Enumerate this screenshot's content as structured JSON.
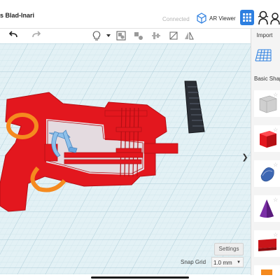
{
  "header": {
    "doc_title": "s Blad-Inari",
    "connected": "Connected",
    "ar_viewer": "AR Viewer"
  },
  "toolbar": {
    "tools": [
      "bulb-icon",
      "dropdown-icon",
      "group-icon",
      "ungroup-icon",
      "align-icon",
      "mirror-icon",
      "flip-icon"
    ]
  },
  "right_panel": {
    "import": "Import",
    "basic_shapes": "Basic Shap",
    "shapes": [
      "box-hole",
      "box",
      "paraboloid",
      "cone",
      "text"
    ]
  },
  "canvas": {
    "settings": "Settings",
    "snap_grid_label": "Snap Grid",
    "snap_grid_value": "1.0 mm"
  },
  "colors": {
    "accent": "#2d7fe0",
    "red": "#e3171e",
    "orange": "#f58a1f",
    "blue_light": "#6aa8e0",
    "dark": "#2b2f36",
    "grid_bg": "#dfeff4",
    "grid_line": "#c2dce6"
  }
}
